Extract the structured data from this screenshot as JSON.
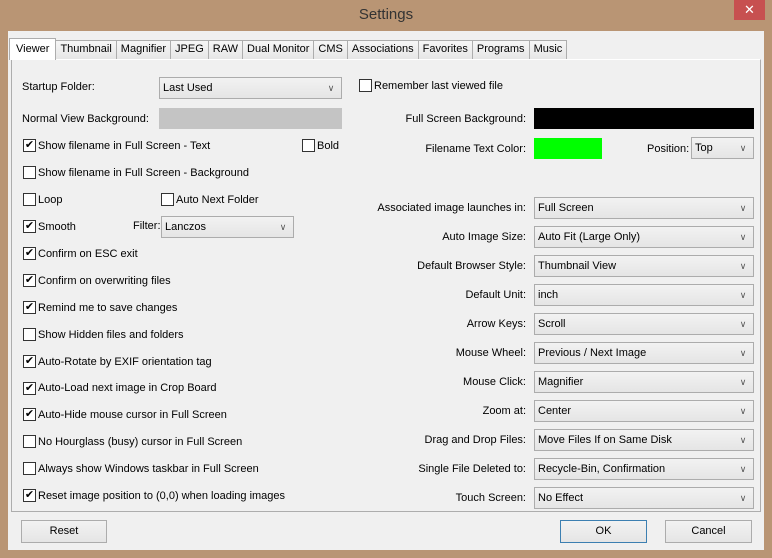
{
  "window": {
    "title": "Settings",
    "close_icon": "close-icon"
  },
  "tabs": [
    {
      "label": "Viewer",
      "active": true
    },
    {
      "label": "Thumbnail"
    },
    {
      "label": "Magnifier"
    },
    {
      "label": "JPEG"
    },
    {
      "label": "RAW"
    },
    {
      "label": "Dual Monitor"
    },
    {
      "label": "CMS"
    },
    {
      "label": "Associations"
    },
    {
      "label": "Favorites"
    },
    {
      "label": "Programs"
    },
    {
      "label": "Music"
    }
  ],
  "left": {
    "startup_folder": {
      "label": "Startup Folder:",
      "value": "Last Used"
    },
    "normal_view_bg": {
      "label": "Normal View Background:",
      "color": "#c4c4c4"
    },
    "show_filename_text": {
      "label": "Show filename in Full Screen - Text",
      "checked": true
    },
    "bold": {
      "label": "Bold",
      "checked": false
    },
    "show_filename_bg": {
      "label": "Show filename in Full Screen - Background",
      "checked": false
    },
    "loop": {
      "label": "Loop",
      "checked": false
    },
    "auto_next_folder": {
      "label": "Auto Next Folder",
      "checked": false
    },
    "smooth": {
      "label": "Smooth",
      "checked": true
    },
    "filter": {
      "label": "Filter:",
      "value": "Lanczos"
    },
    "confirm_esc": {
      "label": "Confirm on ESC exit",
      "checked": true
    },
    "confirm_overwrite": {
      "label": "Confirm on overwriting files",
      "checked": true
    },
    "remind_save": {
      "label": "Remind me to save changes",
      "checked": true
    },
    "show_hidden": {
      "label": "Show Hidden files and folders",
      "checked": false
    },
    "auto_rotate": {
      "label": "Auto-Rotate by EXIF orientation tag",
      "checked": true
    },
    "auto_load": {
      "label": "Auto-Load next image in Crop Board",
      "checked": true
    },
    "auto_hide": {
      "label": "Auto-Hide mouse cursor in Full Screen",
      "checked": true
    },
    "no_hourglass": {
      "label": "No Hourglass (busy) cursor in Full Screen",
      "checked": false
    },
    "always_taskbar": {
      "label": "Always show Windows taskbar in Full Screen",
      "checked": false
    },
    "reset_position": {
      "label": "Reset image position to (0,0) when loading images",
      "checked": true
    }
  },
  "right": {
    "remember_last": {
      "label": "Remember last viewed file",
      "checked": false
    },
    "full_screen_bg": {
      "label": "Full Screen Background:",
      "color": "#000000"
    },
    "filename_text_color": {
      "label": "Filename Text Color:",
      "color": "#00ff00"
    },
    "position": {
      "label": "Position:",
      "value": "Top"
    },
    "dropdowns": [
      {
        "label": "Associated image launches in:",
        "value": "Full Screen"
      },
      {
        "label": "Auto Image Size:",
        "value": "Auto Fit (Large Only)"
      },
      {
        "label": "Default Browser Style:",
        "value": "Thumbnail View"
      },
      {
        "label": "Default Unit:",
        "value": "inch"
      },
      {
        "label": "Arrow Keys:",
        "value": "Scroll"
      },
      {
        "label": "Mouse Wheel:",
        "value": "Previous / Next Image"
      },
      {
        "label": "Mouse Click:",
        "value": "Magnifier"
      },
      {
        "label": "Zoom at:",
        "value": "Center"
      },
      {
        "label": "Drag and Drop Files:",
        "value": "Move Files If on Same Disk"
      },
      {
        "label": "Single File Deleted to:",
        "value": "Recycle-Bin, Confirmation"
      },
      {
        "label": "Touch Screen:",
        "value": "No Effect"
      }
    ]
  },
  "footer": {
    "reset": "Reset",
    "ok": "OK",
    "cancel": "Cancel"
  },
  "icons": {
    "dropdown_arrow": "∨",
    "close": "✕"
  }
}
